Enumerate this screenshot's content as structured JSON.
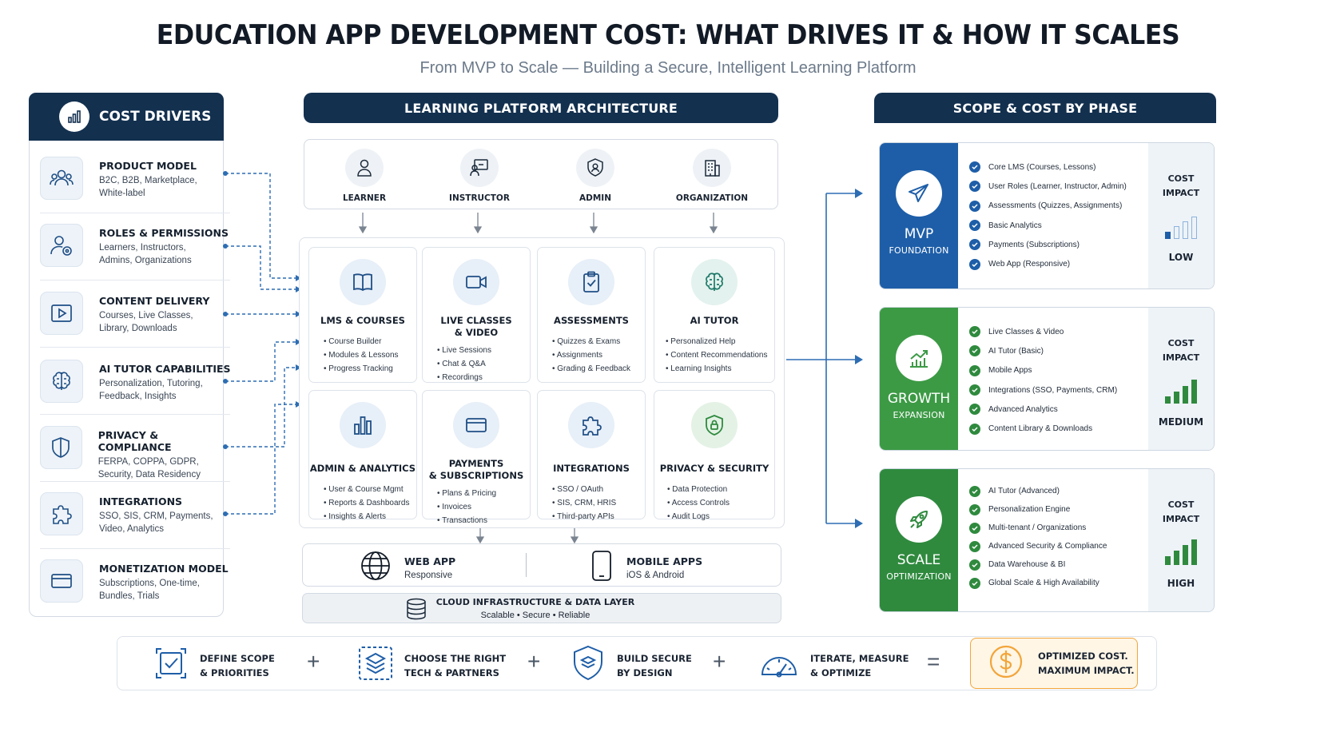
{
  "title": "EDUCATION APP DEVELOPMENT COST: WHAT DRIVES IT & HOW IT SCALES",
  "subtitle": "From MVP to Scale — Building a Secure, Intelligent Learning Platform",
  "colors": {
    "navy": "#13304f",
    "mvp": "#1e5ea8",
    "growth": "#3c9a45",
    "scale": "#2f8a3e",
    "check": "#2f8a3e",
    "accent_orange": "#f2a53a"
  },
  "cost_drivers": {
    "header": "COST DRIVERS",
    "header_icon": "bar-chart-icon",
    "items": [
      {
        "title": "PRODUCT MODEL",
        "line1": "B2C, B2B, Marketplace,",
        "line2": "White-label",
        "icon": "users-icon"
      },
      {
        "title": "ROLES & PERMISSIONS",
        "line1": "Learners, Instructors,",
        "line2": "Admins, Organizations",
        "icon": "user-gear-icon"
      },
      {
        "title": "CONTENT DELIVERY",
        "line1": "Courses, Live Classes,",
        "line2": "Library, Downloads",
        "icon": "play-icon"
      },
      {
        "title": "AI TUTOR CAPABILITIES",
        "line1": "Personalization, Tutoring,",
        "line2": "Feedback, Insights",
        "icon": "brain-icon"
      },
      {
        "title": "PRIVACY & COMPLIANCE",
        "line1": "FERPA, COPPA, GDPR,",
        "line2": "Security, Data Residency",
        "icon": "shield-icon"
      },
      {
        "title": "INTEGRATIONS",
        "line1": "SSO, SIS, CRM, Payments,",
        "line2": "Video, Analytics",
        "icon": "puzzle-icon"
      },
      {
        "title": "MONETIZATION MODEL",
        "line1": "Subscriptions, One-time,",
        "line2": "Bundles, Trials",
        "icon": "card-icon"
      }
    ]
  },
  "architecture": {
    "header": "LEARNING PLATFORM ARCHITECTURE",
    "roles": [
      {
        "label": "LEARNER",
        "icon": "learner-icon"
      },
      {
        "label": "INSTRUCTOR",
        "icon": "instructor-icon"
      },
      {
        "label": "ADMIN",
        "icon": "admin-icon"
      },
      {
        "label": "ORGANIZATION",
        "icon": "organization-icon"
      }
    ],
    "modules": [
      {
        "title1": "LMS & COURSES",
        "title2": "",
        "items": [
          "Course Builder",
          "Modules & Lessons",
          "Progress Tracking"
        ],
        "icon": "book-icon"
      },
      {
        "title1": "LIVE CLASSES",
        "title2": "& VIDEO",
        "items": [
          "Live Sessions",
          "Chat & Q&A",
          "Recordings"
        ],
        "icon": "video-icon"
      },
      {
        "title1": "ASSESSMENTS",
        "title2": "",
        "items": [
          "Quizzes & Exams",
          "Assignments",
          "Grading & Feedback"
        ],
        "icon": "clipboard-check-icon"
      },
      {
        "title1": "AI TUTOR",
        "title2": "",
        "items": [
          "Personalized Help",
          "Content Recommendations",
          "Learning Insights"
        ],
        "icon": "brain-icon"
      },
      {
        "title1": "ADMIN & ANALYTICS",
        "title2": "",
        "items": [
          "User & Course Mgmt",
          "Reports & Dashboards",
          "Insights & Alerts"
        ],
        "icon": "analytics-bars-icon"
      },
      {
        "title1": "PAYMENTS",
        "title2": "& SUBSCRIPTIONS",
        "items": [
          "Plans & Pricing",
          "Invoices",
          "Transactions"
        ],
        "icon": "card-icon"
      },
      {
        "title1": "INTEGRATIONS",
        "title2": "",
        "items": [
          "SSO / OAuth",
          "SIS, CRM, HRIS",
          "Third-party APIs"
        ],
        "icon": "puzzle-icon"
      },
      {
        "title1": "PRIVACY & SECURITY",
        "title2": "",
        "items": [
          "Data Protection",
          "Access Controls",
          "Audit Logs"
        ],
        "icon": "shield-lock-icon"
      }
    ],
    "clients": [
      {
        "title": "WEB APP",
        "sub": "Responsive",
        "icon": "globe-icon"
      },
      {
        "title": "MOBILE APPS",
        "sub": "iOS & Android",
        "icon": "phone-icon"
      }
    ],
    "infra": {
      "title": "CLOUD INFRASTRUCTURE & DATA LAYER",
      "sub": "Scalable • Secure • Reliable",
      "icon": "database-icon"
    }
  },
  "phases": {
    "header": "SCOPE & COST BY PHASE",
    "cost_label1": "COST",
    "cost_label2": "IMPACT",
    "items": [
      {
        "name": "MVP",
        "sub": "FOUNDATION",
        "level": "LOW",
        "bars_filled": 1,
        "icon": "paper-plane-icon",
        "features": [
          "Core LMS (Courses, Lessons)",
          "User Roles (Learner, Instructor, Admin)",
          "Assessments (Quizzes, Assignments)",
          "Basic Analytics",
          "Payments (Subscriptions)",
          "Web App (Responsive)"
        ]
      },
      {
        "name": "GROWTH",
        "sub": "EXPANSION",
        "level": "MEDIUM",
        "bars_filled": 4,
        "icon": "growth-chart-icon",
        "features": [
          "Live Classes & Video",
          "AI Tutor (Basic)",
          "Mobile Apps",
          "Integrations (SSO, Payments, CRM)",
          "Advanced Analytics",
          "Content Library & Downloads"
        ]
      },
      {
        "name": "SCALE",
        "sub": "OPTIMIZATION",
        "level": "HIGH",
        "bars_filled": 4,
        "icon": "rocket-icon",
        "features": [
          "AI Tutor (Advanced)",
          "Personalization Engine",
          "Multi-tenant / Organizations",
          "Advanced Security & Compliance",
          "Data Warehouse & BI",
          "Global Scale & High Availability"
        ]
      }
    ]
  },
  "footer": {
    "steps": [
      {
        "line1": "DEFINE SCOPE",
        "line2": "& PRIORITIES",
        "icon": "target-check-icon"
      },
      {
        "line1": "CHOOSE THE RIGHT",
        "line2": "TECH & PARTNERS",
        "icon": "layers-icon"
      },
      {
        "line1": "BUILD SECURE",
        "line2": "BY DESIGN",
        "icon": "shield-layers-icon"
      },
      {
        "line1": "ITERATE, MEASURE",
        "line2": "& OPTIMIZE",
        "icon": "gauge-icon"
      }
    ],
    "plus": "+",
    "equals": "=",
    "result": {
      "line1": "OPTIMIZED COST.",
      "line2": "MAXIMUM IMPACT.",
      "icon": "dollar-icon"
    }
  }
}
